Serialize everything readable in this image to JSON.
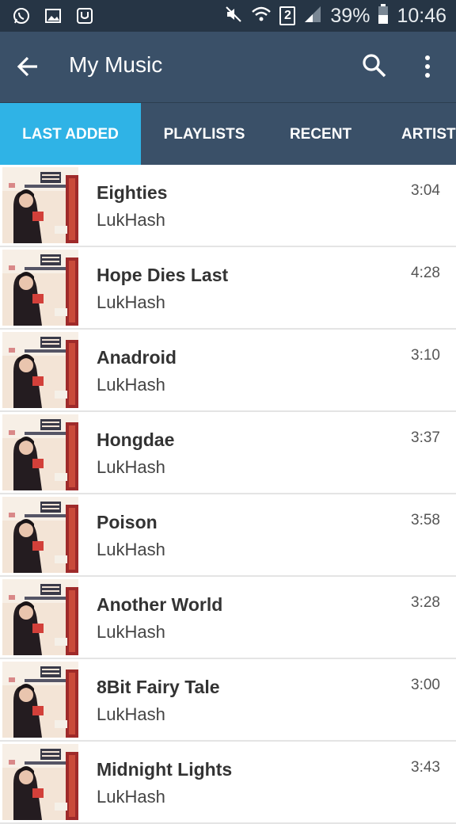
{
  "status_bar": {
    "battery": "39%",
    "time": "10:46",
    "sim": "2",
    "icons": [
      "whatsapp-icon",
      "gallery-icon",
      "voicemail-icon",
      "mute-icon",
      "wifi-icon",
      "signal-icon",
      "battery-icon"
    ]
  },
  "app_bar": {
    "title": "My Music",
    "icons": [
      "back-arrow-icon",
      "search-icon",
      "more-vert-icon"
    ]
  },
  "tabs": [
    {
      "label": "LAST ADDED",
      "active": true
    },
    {
      "label": "PLAYLISTS",
      "active": false
    },
    {
      "label": "RECENT",
      "active": false
    },
    {
      "label": "ARTISTS",
      "active": false
    }
  ],
  "colors": {
    "status_bar": "#263545",
    "app_bar": "#3a5068",
    "active_tab": "#2fb3e6"
  },
  "songs": [
    {
      "title": "Eighties",
      "artist": "LukHash",
      "duration": "3:04"
    },
    {
      "title": "Hope Dies Last",
      "artist": "LukHash",
      "duration": "4:28"
    },
    {
      "title": "Anadroid",
      "artist": "LukHash",
      "duration": "3:10"
    },
    {
      "title": "Hongdae",
      "artist": "LukHash",
      "duration": "3:37"
    },
    {
      "title": "Poison",
      "artist": "LukHash",
      "duration": "3:58"
    },
    {
      "title": "Another World",
      "artist": "LukHash",
      "duration": "3:28"
    },
    {
      "title": "8Bit Fairy Tale",
      "artist": "LukHash",
      "duration": "3:00"
    },
    {
      "title": "Midnight Lights",
      "artist": "LukHash",
      "duration": "3:43"
    }
  ]
}
